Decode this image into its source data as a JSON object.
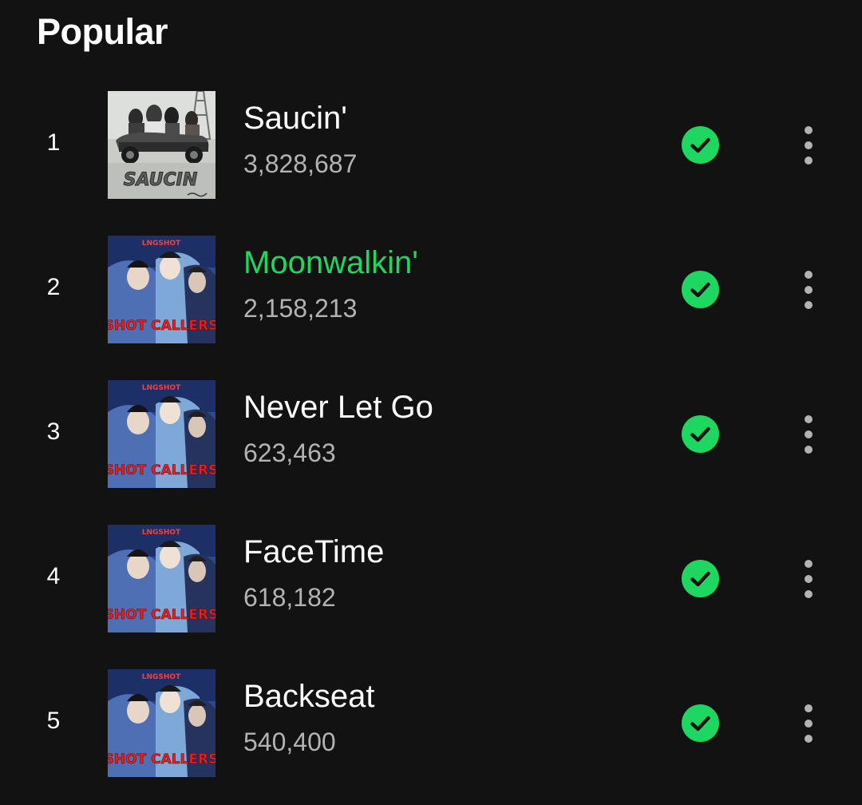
{
  "section": {
    "title": "Popular"
  },
  "colors": {
    "background": "#121212",
    "accent_green": "#1ed760",
    "text_primary": "#ffffff",
    "text_secondary": "#b3b3b3"
  },
  "tracks": [
    {
      "rank": "1",
      "title": "Saucin'",
      "plays": "3,828,687",
      "playing": false,
      "saved": true,
      "art": "saucin-album-cover"
    },
    {
      "rank": "2",
      "title": "Moonwalkin'",
      "plays": "2,158,213",
      "playing": true,
      "saved": true,
      "art": "shot-callers-album-cover"
    },
    {
      "rank": "3",
      "title": "Never Let Go",
      "plays": "623,463",
      "playing": false,
      "saved": true,
      "art": "shot-callers-album-cover"
    },
    {
      "rank": "4",
      "title": "FaceTime",
      "plays": "618,182",
      "playing": false,
      "saved": true,
      "art": "shot-callers-album-cover"
    },
    {
      "rank": "5",
      "title": "Backseat",
      "plays": "540,400",
      "playing": false,
      "saved": true,
      "art": "shot-callers-album-cover"
    }
  ],
  "icons": {
    "saved": "check-circle-icon",
    "more": "more-vertical-icon"
  },
  "album_art_text": {
    "saucin_logo": "SAUCIN",
    "shot_callers_label": "LNGSHOT",
    "shot_callers_title": "SHOT CALLERS"
  }
}
